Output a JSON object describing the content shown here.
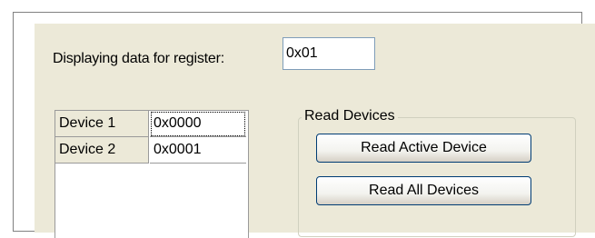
{
  "register": {
    "label": "Displaying data for register:",
    "value": "0x01"
  },
  "devices": [
    {
      "name": "Device 1",
      "value": "0x0000"
    },
    {
      "name": "Device 2",
      "value": "0x0001"
    }
  ],
  "read_group": {
    "title": "Read Devices",
    "read_active_label": "Read Active Device",
    "read_all_label": "Read All Devices"
  }
}
